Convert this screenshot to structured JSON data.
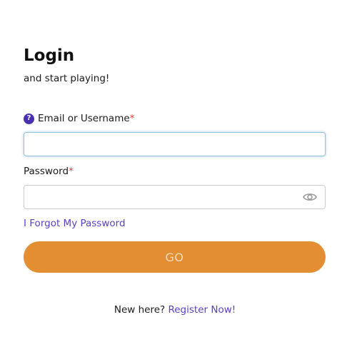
{
  "header": {
    "title": "Login",
    "subtitle": "and start playing!"
  },
  "form": {
    "email": {
      "help_icon_glyph": "?",
      "label": "Email or Username",
      "required_mark": "*",
      "value": "",
      "placeholder": ""
    },
    "password": {
      "label": "Password",
      "required_mark": "*",
      "value": "",
      "placeholder": "",
      "toggle_icon": "eye-icon"
    },
    "forgot_password_link": "I Forgot My Password",
    "submit_label": "GO"
  },
  "footer": {
    "prompt": "New here?",
    "register_link": "Register Now!"
  },
  "colors": {
    "accent": "#e38e32",
    "link": "#5b3fc4",
    "help_icon": "#4a2fb3",
    "required": "#e03a3a"
  }
}
